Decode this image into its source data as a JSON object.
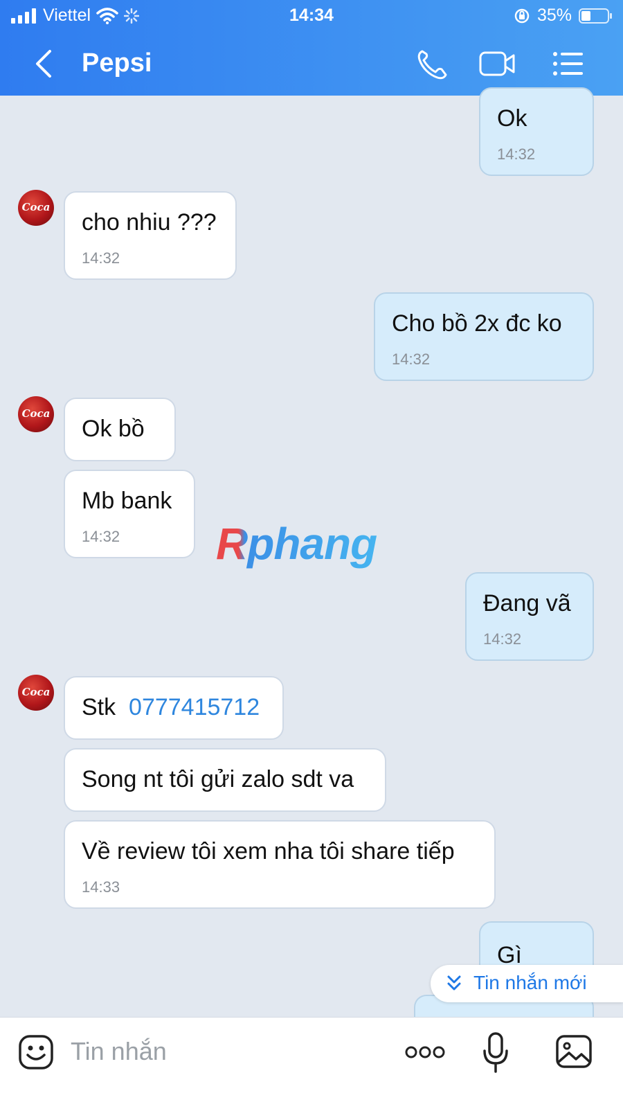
{
  "status_bar": {
    "carrier": "Viettel",
    "time": "14:34",
    "battery": "35%"
  },
  "header": {
    "title": "Pepsi"
  },
  "messages": [
    {
      "text": "Ok",
      "time": "14:32"
    },
    {
      "text": "cho nhiu ???",
      "time": "14:32"
    },
    {
      "text": "Cho bồ 2x đc ko",
      "time": "14:32"
    },
    {
      "text": "Ok bồ"
    },
    {
      "text": "Mb bank",
      "time": "14:32"
    },
    {
      "text": "Đang vã",
      "time": "14:32"
    },
    {
      "prefix": "Stk",
      "link": "0777415712"
    },
    {
      "text": "Song nt tôi gửi zalo sdt va"
    },
    {
      "text": "Về review tôi xem nha tôi share tiếp",
      "time": "14:33"
    },
    {
      "text": "Gì"
    }
  ],
  "avatar_text": "Coca",
  "watermark": "Rphang",
  "new_message_pill": "Tin nhắn mới",
  "input": {
    "placeholder": "Tin nhắn"
  },
  "colors": {
    "header_start": "#2f7cf0",
    "header_end": "#4aa1f3",
    "background": "#e2e8f0",
    "outgoing_bubble": "#d6ecfb",
    "incoming_bubble": "#ffffff",
    "link": "#2e86de"
  }
}
